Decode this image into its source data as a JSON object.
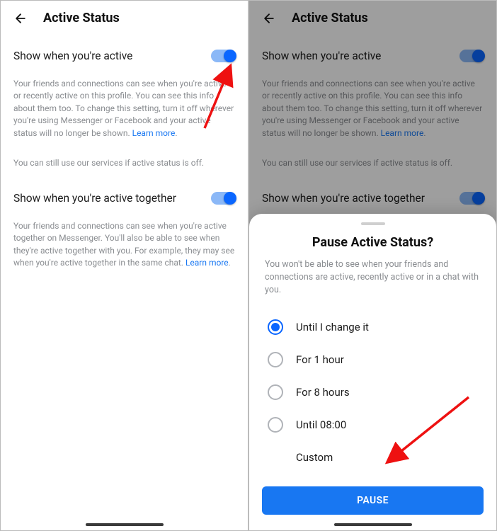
{
  "header": {
    "title": "Active Status"
  },
  "settings": {
    "active": {
      "label": "Show when you're active",
      "desc_pre": "Your friends and connections can see when you're active or recently active on this profile. You can see this info about them too. To change this setting, turn it off wherever you're using Messenger or Facebook and your active status will no longer be shown. ",
      "learn_more": "Learn more",
      "desc_post": "."
    },
    "off_note": "You can still use our services if active status is off.",
    "together": {
      "label": "Show when you're active together",
      "desc_pre": "Your friends and connections can see when you're active together on Messenger. You'll also be able to see when they're active together with you. For example, they may see when you're active together in the same chat. ",
      "learn_more": "Learn more",
      "desc_post": "."
    }
  },
  "sheet": {
    "title": "Pause Active Status?",
    "desc": "You won't be able to see when your friends and connections are active, recently active or in a chat with you.",
    "options": [
      "Until I change it",
      "For 1 hour",
      "For 8 hours",
      "Until 08:00",
      "Custom"
    ],
    "button": "PAUSE"
  }
}
